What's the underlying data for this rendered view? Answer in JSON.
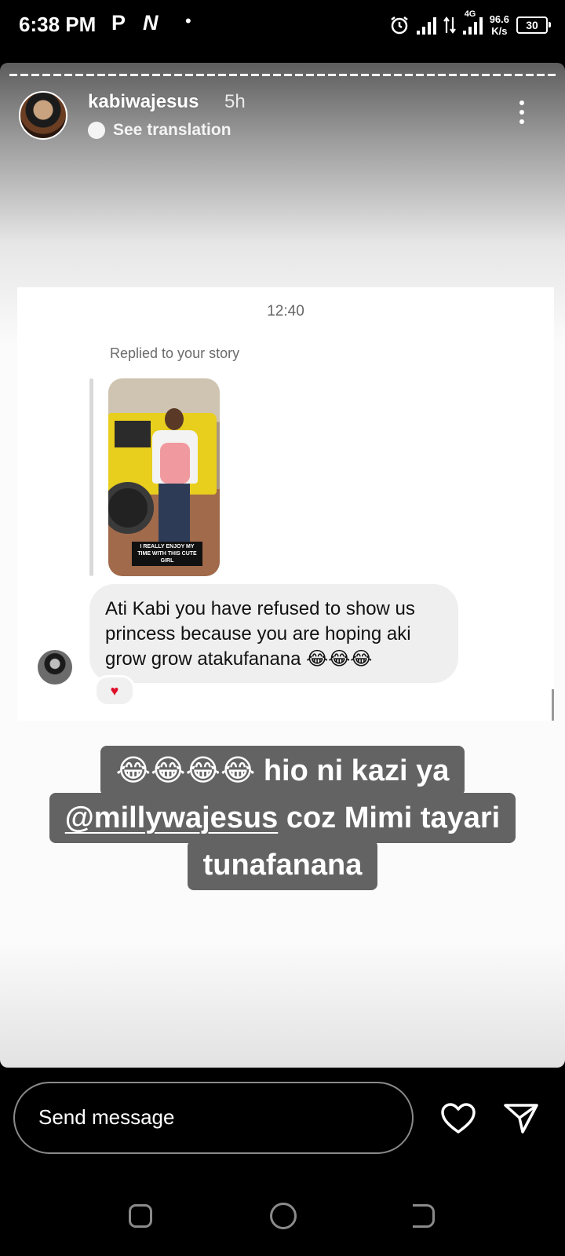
{
  "status_bar": {
    "time": "6:38 PM",
    "app_icon_1": "P",
    "app_icon_2": "N",
    "dot": "•",
    "network": "4G",
    "speed_value": "96.6",
    "speed_unit": "K/s",
    "battery": "30"
  },
  "story": {
    "username": "kabiwajesus",
    "time_ago": "5h",
    "translation_label": "See translation",
    "screenshot": {
      "timestamp": "12:40",
      "replied_label": "Replied to your story",
      "story_thumbnail_caption": "I REALLY ENJOY MY TIME WITH THIS CUTE GIRL",
      "message": "Ati Kabi you have refused to show us princess because you are hoping aki grow grow atakufanana 😂😂😂",
      "reaction": "♥"
    },
    "caption": {
      "line1": "😂😂😂😂 hio ni kazi ya",
      "mention": "@millywajesus",
      "line2_rest": " coz Mimi tayari",
      "line3": "tunafanana"
    }
  },
  "reply_bar": {
    "placeholder": "Send message"
  },
  "icons": {
    "like": "heart-icon",
    "send": "send-icon",
    "options": "more-options-icon"
  }
}
